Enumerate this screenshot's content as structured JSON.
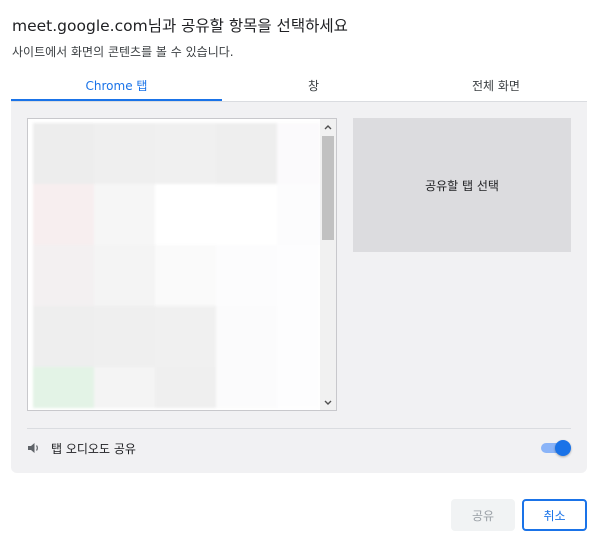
{
  "dialog": {
    "title": "meet.google.com님과 공유할 항목을 선택하세요",
    "subtitle": "사이트에서 화면의 콘텐츠를 볼 수 있습니다."
  },
  "tabs": [
    {
      "label": "Chrome 탭",
      "active": true
    },
    {
      "label": "창",
      "active": false
    },
    {
      "label": "전체 화면",
      "active": false
    }
  ],
  "preview": {
    "text": "공유할 탭 선택"
  },
  "audio": {
    "label": "탭 오디오도 공유",
    "enabled": true,
    "icon": "speaker-icon"
  },
  "buttons": {
    "share": "공유",
    "cancel": "취소"
  },
  "colors": {
    "accent": "#1a73e8",
    "toggle_track": "#8ab4f8",
    "panel_bg": "#f1f1f3",
    "preview_bg": "#dcdcdf"
  }
}
